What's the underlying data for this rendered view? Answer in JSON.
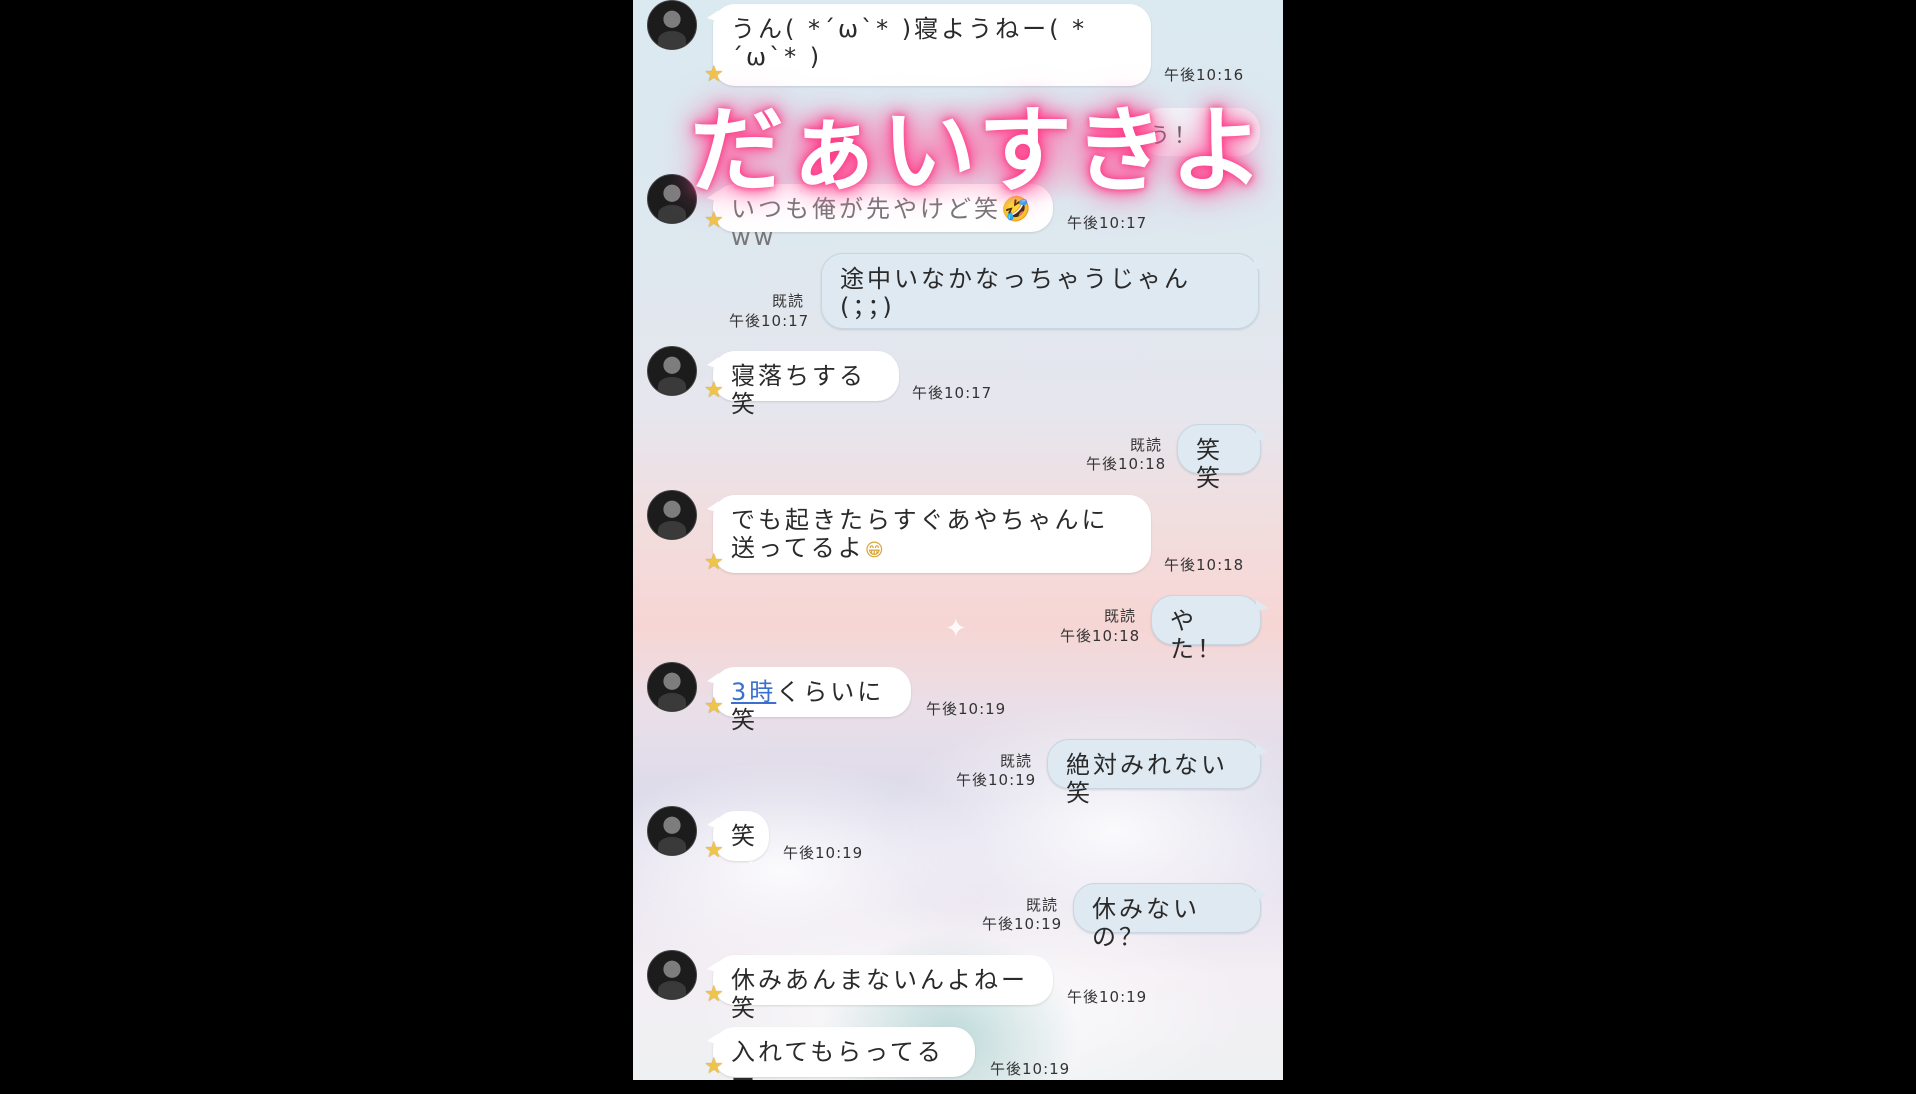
{
  "overlay_title": "だぁいすきよ",
  "ghost_bubble_text": "う！",
  "messages": [
    {
      "side": "in",
      "text": "うん( *´ω`* )寝ようねー( *´ω`* )",
      "time": "午後10:16"
    },
    {
      "side": "in",
      "text": "いつも俺が先やけど笑🤣ww",
      "time": "午後10:17"
    },
    {
      "side": "me",
      "text": "途中いなかなっちゃうじゃん\n(；；)",
      "read": "既読",
      "time": "午後10:17"
    },
    {
      "side": "in",
      "text": "寝落ちする笑",
      "time": "午後10:17"
    },
    {
      "side": "me",
      "text": "笑笑",
      "read": "既読",
      "time": "午後10:18"
    },
    {
      "side": "in",
      "text": "でも起きたらすぐあやちゃんに送ってるよ",
      "emoji": "😁",
      "time": "午後10:18"
    },
    {
      "side": "me",
      "text": "やた！",
      "read": "既読",
      "time": "午後10:18"
    },
    {
      "side": "in",
      "link": "3時",
      "text": "くらいに笑",
      "time": "午後10:19"
    },
    {
      "side": "me",
      "text": "絶対みれない笑",
      "read": "既読",
      "time": "午後10:19"
    },
    {
      "side": "in",
      "text": "笑",
      "time": "午後10:19"
    },
    {
      "side": "me",
      "text": "休みないの？",
      "read": "既読",
      "time": "午後10:19"
    },
    {
      "side": "in",
      "text": "休みあんまないんよねー笑",
      "time": "午後10:19"
    },
    {
      "side": "in",
      "text": "入れてもらってるー",
      "time": "午後10:19"
    }
  ],
  "icons": {
    "avatar": "avatar-image",
    "star": "star-icon"
  },
  "colors": {
    "bubble_in": "#ffffff",
    "bubble_me": "#dfe9f2",
    "overlay_glow": "#ff3a86",
    "link": "#3b6fd0"
  }
}
